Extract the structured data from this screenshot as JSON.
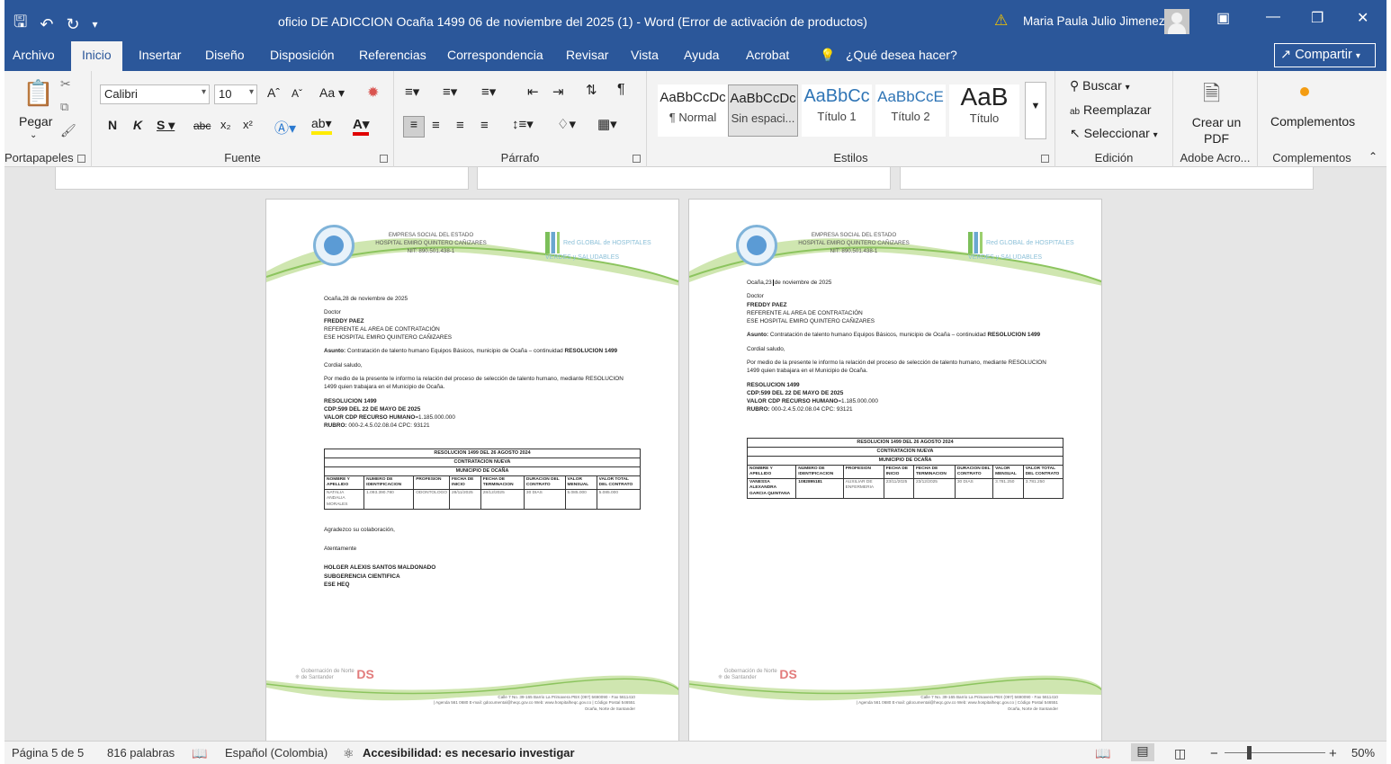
{
  "titlebar": {
    "title": "oficio DE ADICCION Ocaña 1499  06 de noviembre del 2025 (1)  -  Word (Error de activación de productos)",
    "user": "Maria Paula Julio Jimenez"
  },
  "tabs": [
    "Archivo",
    "Inicio",
    "Insertar",
    "Diseño",
    "Disposición",
    "Referencias",
    "Correspondencia",
    "Revisar",
    "Vista",
    "Ayuda",
    "Acrobat"
  ],
  "tell_me": "¿Qué desea hacer?",
  "share_label": "Compartir",
  "ribbon": {
    "paste": "Pegar",
    "font_name": "Calibri",
    "font_size": "10",
    "groups": {
      "clipboard": "Portapapeles",
      "font": "Fuente",
      "paragraph": "Párrafo",
      "styles": "Estilos",
      "editing": "Edición",
      "adobe": "Adobe Acro...",
      "addins": "Complementos"
    },
    "styles": [
      {
        "preview": "AaBbCcDc",
        "name": "¶ Normal"
      },
      {
        "preview": "AaBbCcDc",
        "name": "Sin espaci..."
      },
      {
        "preview": "AaBbCc",
        "name": "Título 1"
      },
      {
        "preview": "AaBbCcE",
        "name": "Título 2"
      },
      {
        "preview": "AaB",
        "name": "Título"
      }
    ],
    "find": "Buscar",
    "replace": "Reemplazar",
    "select": "Seleccionar",
    "create_pdf": "Crear un PDF",
    "addins_btn": "Complementos"
  },
  "letterhead": {
    "line1": "EMPRESA SOCIAL DEL ESTADO",
    "line2": "HOSPITAL EMIRO QUINTERO CAÑIZARES",
    "line3": "NIT: 890.501.438-1",
    "network": "Red GLOBAL de HOSPITALES VERDES y SALUDABLES"
  },
  "pages": [
    {
      "date": "Ocaña,28 de noviembre de 2025",
      "salutation_title": "Doctor",
      "recipient": "FREDDY PAEZ",
      "recipient_role": "REFERENTE AL AREA DE CONTRATACIÓN",
      "recipient_org": "ESE HOSPITAL EMIRO QUINTERO CAÑIZARES",
      "subject_label": "Asunto:",
      "subject": "Contratación de talento humano Equipos Básicos, municipio de Ocaña – continuidad",
      "subject_res": "RESOLUCION 1499",
      "greeting": "Cordial saludo,",
      "paragraph": "Por medio de la presente le informo la relación del proceso de selección de talento humano, mediante RESOLUCION 1499 quien trabajara en el Municipio de Ocaña.",
      "res": "RESOLUCION 1499",
      "cdp": "CDP:599 DEL 22 DE MAYO DE 2025",
      "valor_label": "VALOR CDP RECURSO HUMANO",
      "valor": "=1.185.000.000",
      "rubro_label": "RUBRO:",
      "rubro": "000-2.4.5.02.08.04 CPC: 93121",
      "table_title1": "RESOLUCION 1499 DEL 26 AGOSTO 2024",
      "table_title2": "CONTRATACION NUEVA",
      "table_title3": "MUNICIPIO DE OCAÑA",
      "headers": [
        "NOMBRE Y APELLIDO",
        "NUMERO DE IDENTIFICACION",
        "PROFESION",
        "FECHA DE INICIO",
        "FECHA DE TERMINACION",
        "DURACION DEL CONTRATO",
        "VALOR MENSUAL",
        "VALOR TOTAL DEL CONTRATO"
      ],
      "row": [
        "NATALIA ANDALIA MORALES",
        "1.093.390.780",
        "ODONTOLOGO",
        "28/11/2025",
        "28/12/2025",
        "30 DIAS",
        "5.085.000",
        "5.085.000"
      ],
      "closing": "Agradezco su colaboración,",
      "regards": "Atentamente",
      "signer": "HOLGER ALEXIS SANTOS MALDONADO",
      "signer_role": "SUBGERENCIA CIENTIFICA",
      "signer_org": "ESE HEQ"
    },
    {
      "date_a": "Ocaña,23",
      "date_b": "de noviembre de 2025",
      "salutation_title": "Doctor",
      "recipient": "FREDDY PAEZ",
      "recipient_role": "REFERENTE AL AREA DE CONTRATACIÓN",
      "recipient_org": "ESE HOSPITAL EMIRO QUINTERO CAÑIZARES",
      "subject_label": "Asunto:",
      "subject": "Contratación de talento humano Equipos Básicos, municipio de Ocaña – continuidad",
      "subject_res": "RESOLUCION 1499",
      "greeting": "Cordial saludo,",
      "paragraph": "Por medio de la presente le informo la relación del proceso de selección de talento humano, mediante RESOLUCION 1499 quien trabajara en el Municipio de Ocaña.",
      "res": "RESOLUCION 1499",
      "cdp": "CDP:599 DEL 22 DE MAYO DE 2025",
      "valor_label": "VALOR CDP RECURSO HUMANO",
      "valor": "=1.185.000.000",
      "rubro_label": "RUBRO:",
      "rubro": "000-2.4.5.02.08.04 CPC: 93121",
      "table_title1": "RESOLUCION 1499 DEL 26 AGOSTO 2024",
      "table_title2": "CONTRATACION NUEVA",
      "table_title3": "MUNICIPIO DE OCAÑA",
      "headers": [
        "NOMBRE Y APELLIDO",
        "NUMERO DE IDENTIFICACION",
        "PROFESION",
        "FECHA DE INICIO",
        "FECHA DE TERMINACION",
        "DURACION DEL CONTRATO",
        "VALOR MENSUAL",
        "VALOR TOTAL DEL CONTRATO"
      ],
      "row": [
        "VANESSA ALEXANDRA GARCIA QUINTANA",
        "1082895181",
        "AUXILIAR DE ENFERMERIA",
        "23/11/2025",
        "23/12/2025",
        "30 DIAS",
        "3.781.250",
        "3.781.250"
      ]
    }
  ],
  "footer": {
    "gov": "Gobernación de Norte de Santander",
    "address": "Calle 7 No. 39-165 Barrio La Primavera PBX (097) 5690090 - Fax 5611410",
    "contact": "| Agenda 561 0680 E-mail: gdocumental@heqc.gov.co Web: www.hospitalheqc.gov.co | Código Postal 546551",
    "city": "Ocaña, Norte de Santander"
  },
  "status": {
    "page": "Página 5 de 5",
    "words": "816 palabras",
    "language": "Español (Colombia)",
    "accessibility": "Accesibilidad: es necesario investigar",
    "zoom": "50%"
  }
}
